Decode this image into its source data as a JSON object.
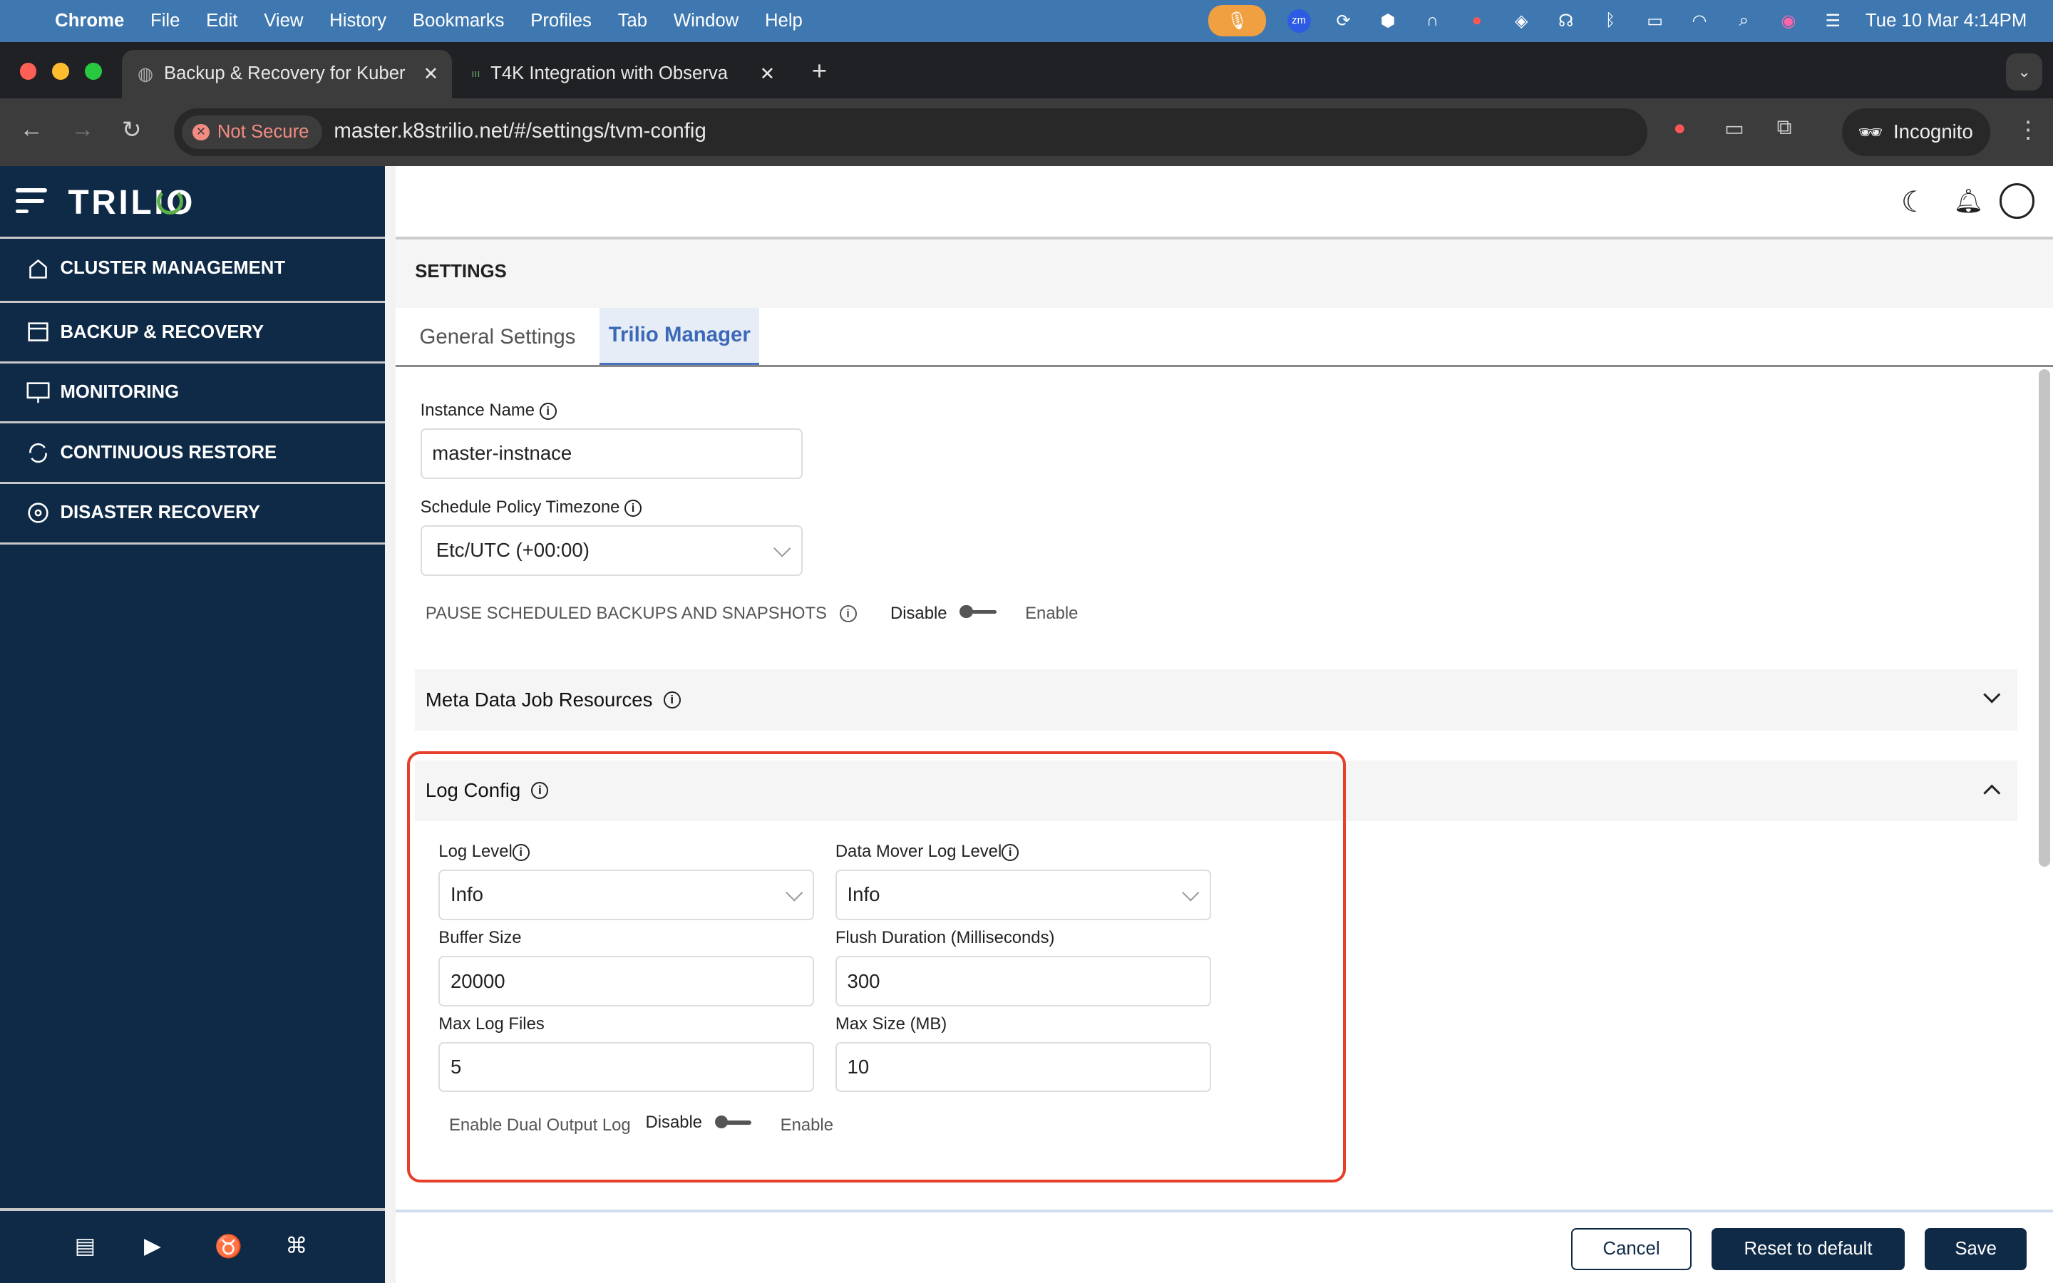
{
  "menubar": {
    "app": "Chrome",
    "items": [
      "File",
      "Edit",
      "View",
      "History",
      "Bookmarks",
      "Profiles",
      "Tab",
      "Window",
      "Help"
    ],
    "clock": "Tue 10 Mar  4:14PM"
  },
  "browser": {
    "tabs": [
      {
        "title": "Backup & Recovery for Kuber"
      },
      {
        "title": "T4K Integration with Observa"
      }
    ],
    "security": "Not Secure",
    "url": "master.k8strilio.net/#/settings/tvm-config",
    "profile": "Incognito"
  },
  "sidebar": {
    "logo": "TRILIO",
    "items": [
      {
        "label": "CLUSTER MANAGEMENT",
        "icon": "home-icon"
      },
      {
        "label": "BACKUP & RECOVERY",
        "icon": "backup-icon"
      },
      {
        "label": "MONITORING",
        "icon": "monitor-icon"
      },
      {
        "label": "CONTINUOUS RESTORE",
        "icon": "sync-icon"
      },
      {
        "label": "DISASTER RECOVERY",
        "icon": "disaster-recovery-icon"
      }
    ]
  },
  "page": {
    "title": "SETTINGS",
    "tabs": [
      "General Settings",
      "Trilio Manager"
    ],
    "active_tab": 1
  },
  "form": {
    "instance_name": {
      "label": "Instance Name",
      "value": "master-instnace"
    },
    "timezone": {
      "label": "Schedule Policy Timezone",
      "value": "Etc/UTC (+00:00)"
    },
    "pause": {
      "label": "PAUSE SCHEDULED BACKUPS AND SNAPSHOTS",
      "off": "Disable",
      "on": "Enable",
      "enabled": false
    },
    "meta_section": "Meta Data Job Resources",
    "log_section": "Log Config",
    "log_level": {
      "label": "Log Level",
      "value": "Info"
    },
    "dm_log_level": {
      "label": "Data Mover Log Level",
      "value": "Info"
    },
    "buffer_size": {
      "label": "Buffer Size",
      "value": "20000"
    },
    "flush": {
      "label": "Flush Duration (Milliseconds)",
      "value": "300"
    },
    "max_files": {
      "label": "Max Log Files",
      "value": "5"
    },
    "max_size": {
      "label": "Max Size (MB)",
      "value": "10"
    },
    "dual": {
      "label": "Enable Dual Output Log",
      "off": "Disable",
      "on": "Enable",
      "enabled": false
    }
  },
  "footer": {
    "cancel": "Cancel",
    "reset": "Reset to default",
    "save": "Save"
  },
  "colors": {
    "sidebar": "#0f2a47",
    "accent": "#4a72c0",
    "highlight": "#e5402a"
  }
}
